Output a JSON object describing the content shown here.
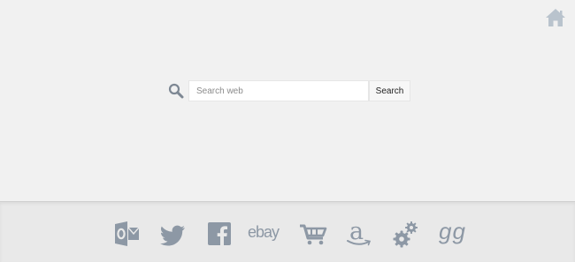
{
  "search": {
    "placeholder": "Search web",
    "value": "",
    "button_label": "Search"
  },
  "dock": {
    "items": [
      {
        "name": "outlook",
        "icon": "outlook-icon"
      },
      {
        "name": "twitter",
        "icon": "twitter-icon"
      },
      {
        "name": "facebook",
        "icon": "facebook-icon"
      },
      {
        "name": "ebay",
        "icon": "ebay-icon",
        "text": "ebay"
      },
      {
        "name": "shopping",
        "icon": "shopping-cart-icon"
      },
      {
        "name": "amazon",
        "icon": "amazon-icon",
        "text": "a"
      },
      {
        "name": "settings",
        "icon": "gears-icon"
      },
      {
        "name": "goodgame",
        "icon": "gg-icon",
        "text": "gg"
      }
    ]
  },
  "colors": {
    "background": "#f1f1f1",
    "dock_background": "#e9e9e9",
    "icon": "#8d98a5",
    "home_icon": "#b9c3cd"
  }
}
